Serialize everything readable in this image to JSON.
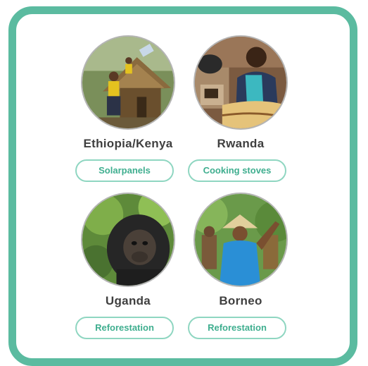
{
  "projects": [
    {
      "country": "Ethiopia/Kenya",
      "tag": "Solarpanels",
      "photo_icon": "hut-with-solar-panel-photo"
    },
    {
      "country": "Rwanda",
      "tag": "Cooking stoves",
      "photo_icon": "woman-at-stove-photo"
    },
    {
      "country": "Uganda",
      "tag": "Reforestation",
      "photo_icon": "chimpanzee-photo"
    },
    {
      "country": "Borneo",
      "tag": "Reforestation",
      "photo_icon": "farmer-in-forest-photo"
    }
  ],
  "colors": {
    "frame_border": "#5bbba0",
    "tag_border": "#8fd6c1",
    "tag_text": "#3fae8f",
    "country_text": "#3f3f3f"
  }
}
